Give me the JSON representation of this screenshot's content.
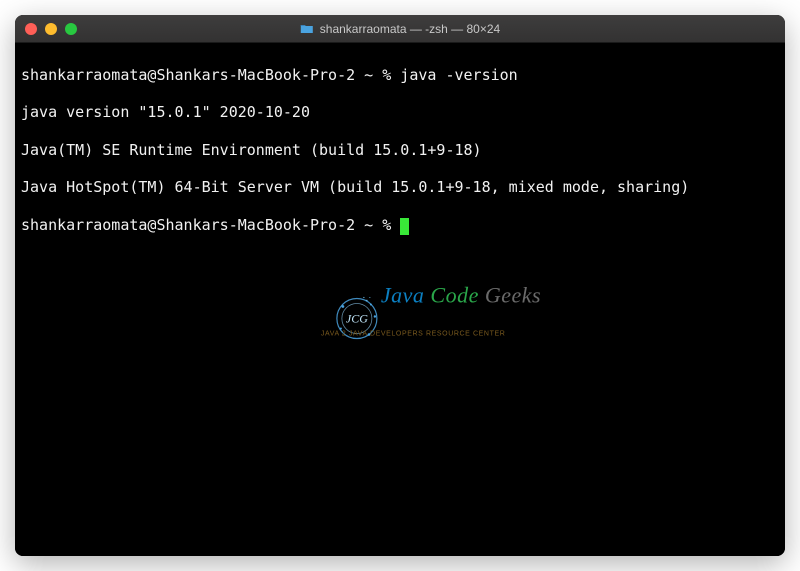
{
  "window": {
    "title": "shankarraomata — -zsh — 80×24"
  },
  "terminal": {
    "lines": [
      "shankarraomata@Shankars-MacBook-Pro-2 ~ % java -version",
      "java version \"15.0.1\" 2020-10-20",
      "Java(TM) SE Runtime Environment (build 15.0.1+9-18)",
      "Java HotSpot(TM) 64-Bit Server VM (build 15.0.1+9-18, mixed mode, sharing)"
    ],
    "prompt": "shankarraomata@Shankars-MacBook-Pro-2 ~ % "
  },
  "watermark": {
    "main_java": "Java",
    "main_code": " Code",
    "main_geeks": " Geeks",
    "sub": "Java 2 Java Developers Resource Center"
  }
}
